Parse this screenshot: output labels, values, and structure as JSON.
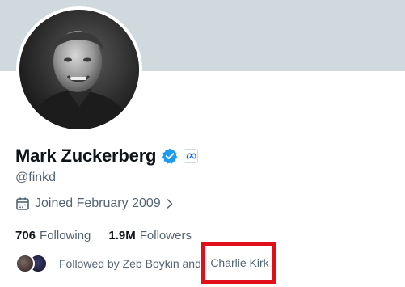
{
  "profile": {
    "name": "Mark Zuckerberg",
    "handle": "@fink​d",
    "verified_icon": "verified-badge-icon",
    "affiliate_icon": "meta-logo-icon",
    "joined": "Joined February 2009",
    "joined_icon": "calendar-icon",
    "chevron_icon": "chevron-right-icon"
  },
  "stats": {
    "following_count": "706",
    "following_label": "Following",
    "followers_count": "1.9M",
    "followers_label": "Followers"
  },
  "followed_by": {
    "prefix": "Followed by Zeb Boykin and",
    "highlighted": "Charlie Kirk"
  },
  "colors": {
    "banner": "#cfd9de",
    "verified": "#1d9bf0",
    "highlight": "#e0101a",
    "secondary_text": "#536471"
  }
}
